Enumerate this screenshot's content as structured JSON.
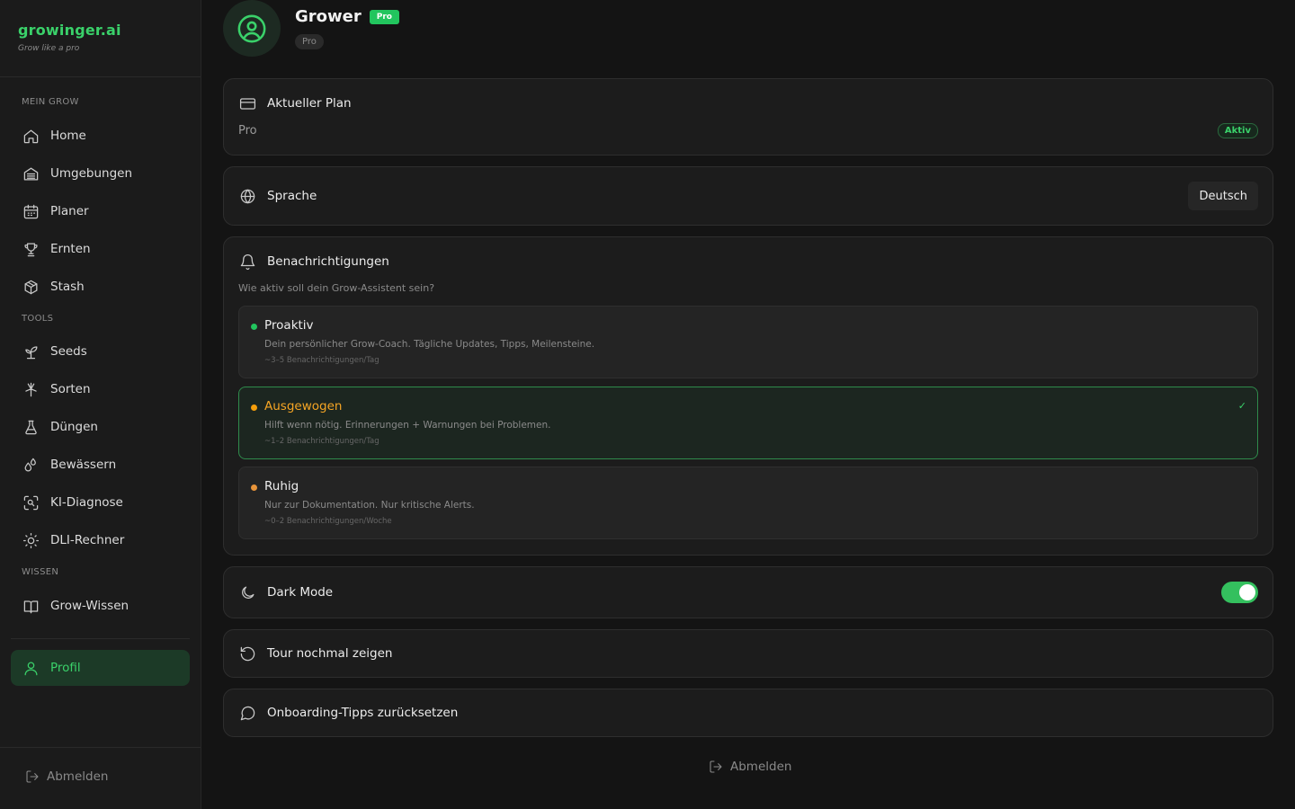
{
  "brand": {
    "name": "growinger.ai",
    "tagline": "Grow like a pro"
  },
  "sidebar": {
    "sections": {
      "mein_grow": "MEIN GROW",
      "tools": "TOOLS",
      "wissen": "WISSEN"
    },
    "items": [
      {
        "label": "Home",
        "icon": "home-icon"
      },
      {
        "label": "Umgebungen",
        "icon": "tent-icon"
      },
      {
        "label": "Planer",
        "icon": "calendar-icon"
      },
      {
        "label": "Ernten",
        "icon": "trophy-icon"
      },
      {
        "label": "Stash",
        "icon": "box-icon"
      },
      {
        "label": "Seeds",
        "icon": "sprout-icon"
      },
      {
        "label": "Sorten",
        "icon": "strain-icon"
      },
      {
        "label": "Düngen",
        "icon": "flask-icon"
      },
      {
        "label": "Bewässern",
        "icon": "droplets-icon"
      },
      {
        "label": "KI-Diagnose",
        "icon": "scan-icon"
      },
      {
        "label": "DLI-Rechner",
        "icon": "sun-icon"
      },
      {
        "label": "Grow-Wissen",
        "icon": "book-icon"
      }
    ],
    "active_item": {
      "label": "Profil",
      "icon": "user-icon"
    },
    "logout_label": "Abmelden"
  },
  "profile": {
    "name": "Grower",
    "badge": "Pro",
    "plan_chip": "Pro"
  },
  "plan_card": {
    "title": "Aktueller Plan",
    "plan": "Pro",
    "status": "Aktiv"
  },
  "language_card": {
    "title": "Sprache",
    "value": "Deutsch"
  },
  "notifications": {
    "title": "Benachrichtigungen",
    "subtitle": "Wie aktiv soll dein Grow-Assistent sein?",
    "options": [
      {
        "title": "Proaktiv",
        "desc": "Dein persönlicher Grow-Coach. Tägliche Updates, Tipps, Meilensteine.",
        "freq": "~3–5 Benachrichtigungen/Tag",
        "dot_color": "#22c55e",
        "title_color": "#ececec",
        "selected": false
      },
      {
        "title": "Ausgewogen",
        "desc": "Hilft wenn nötig. Erinnerungen + Warnungen bei Problemen.",
        "freq": "~1–2 Benachrichtigungen/Tag",
        "dot_color": "#f59e0b",
        "title_color": "#f5a524",
        "selected": true
      },
      {
        "title": "Ruhig",
        "desc": "Nur zur Dokumentation. Nur kritische Alerts.",
        "freq": "~0–2 Benachrichtigungen/Woche",
        "dot_color": "#e8943a",
        "title_color": "#ececec",
        "selected": false
      }
    ],
    "check_mark": "✓"
  },
  "dark_mode": {
    "title": "Dark Mode",
    "enabled": true
  },
  "tour": {
    "title": "Tour nochmal zeigen"
  },
  "onboarding": {
    "title": "Onboarding-Tipps zurücksetzen"
  },
  "footer": {
    "logout_label": "Abmelden"
  },
  "colors": {
    "accent": "#3ad16a",
    "background": "#141414",
    "card": "#1c1c1c"
  }
}
